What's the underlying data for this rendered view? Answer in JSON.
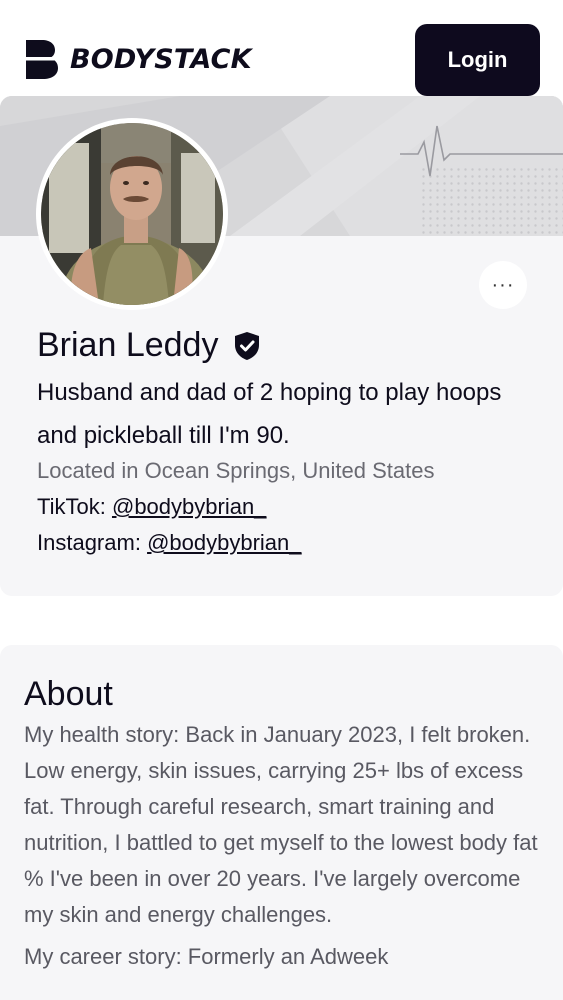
{
  "header": {
    "brand": "BODYSTACK",
    "login_label": "Login"
  },
  "profile": {
    "name": "Brian Leddy",
    "verified": true,
    "more_label": "···",
    "bio": "Husband and dad of 2 hoping to play hoops and pickleball till I'm 90.",
    "location": "Located in Ocean Springs, United States",
    "tiktok_label": "TikTok:",
    "tiktok_handle": "@bodybybrian_",
    "instagram_label": "Instagram:",
    "instagram_handle": "@bodybybrian_"
  },
  "about": {
    "title": "About",
    "paragraph_1": "My health story: Back in January 2023, I felt broken. Low energy, skin issues, carrying 25+ lbs of excess fat. Through careful research, smart training and nutrition, I battled to get myself to the lowest body fat % I've been in over 20 years. I've largely overcome my skin and energy challenges.",
    "paragraph_2": "My career story: Formerly an Adweek"
  },
  "icons": {
    "logo": "bodystack-logo-icon",
    "verified": "verified-badge-icon",
    "more": "more-options-icon"
  },
  "colors": {
    "primary_dark": "#0e0a1e",
    "card_bg": "#f6f6f8",
    "muted_text": "#6a6a72"
  }
}
